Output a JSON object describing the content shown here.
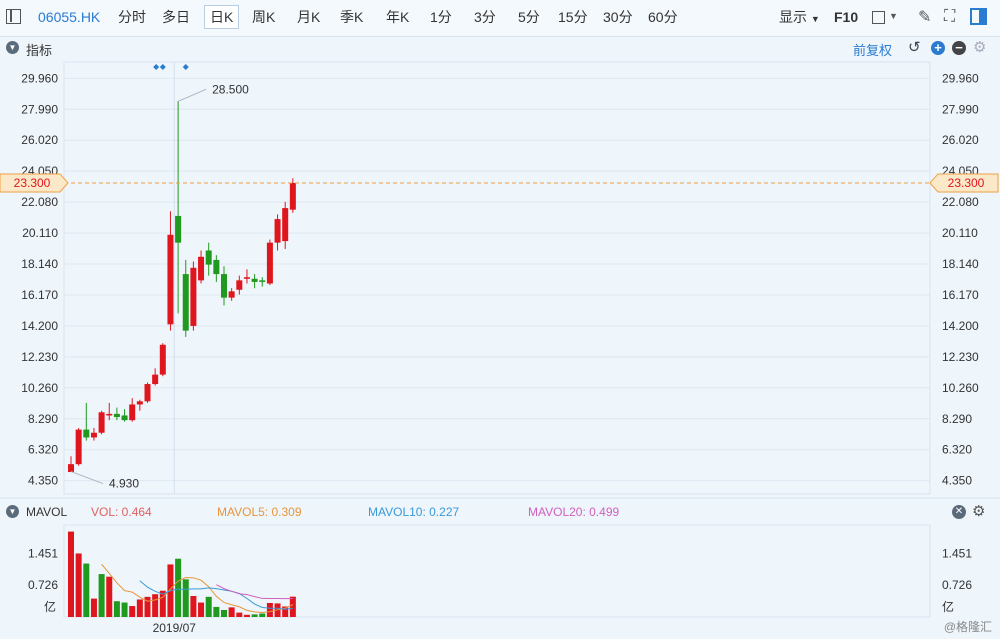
{
  "toolbar": {
    "symbol": "06055.HK",
    "periods": [
      "分时",
      "多日",
      "日K",
      "周K",
      "月K",
      "季K",
      "年K",
      "1分",
      "3分",
      "5分",
      "15分",
      "30分",
      "60分"
    ],
    "active_period": "日K",
    "display_label": "显示",
    "f10_label": "F10"
  },
  "indicator_bar": {
    "label": "指标",
    "adjust_label": "前复权"
  },
  "main_chart": {
    "y_ticks": [
      "29.960",
      "27.990",
      "26.020",
      "24.050",
      "22.080",
      "20.110",
      "18.140",
      "16.170",
      "14.200",
      "12.230",
      "10.260",
      "8.290",
      "6.320",
      "4.350"
    ],
    "current_price": "23.300",
    "high_label": "28.500",
    "low_label": "4.930"
  },
  "volume_bar": {
    "label": "MAVOL",
    "vol": "VOL: 0.464",
    "mavol5": "MAVOL5: 0.309",
    "mavol10": "MAVOL10: 0.227",
    "mavol20": "MAVOL20: 0.499",
    "y_ticks": [
      "1.451",
      "0.726"
    ],
    "unit": "亿",
    "x_label": "2019/07"
  },
  "watermark": "@格隆汇",
  "colors": {
    "up": "#e0161e",
    "down": "#1f9a1f",
    "accent": "#2b7bd0",
    "price_line": "#f0a040"
  },
  "chart_data": {
    "type": "candlestick",
    "ylim": [
      3.5,
      31.0
    ],
    "candles": [
      {
        "o": 4.9,
        "c": 5.4,
        "h": 5.9,
        "l": 4.93
      },
      {
        "o": 5.4,
        "c": 7.6,
        "h": 7.7,
        "l": 5.3
      },
      {
        "o": 7.6,
        "c": 7.1,
        "h": 9.3,
        "l": 6.9
      },
      {
        "o": 7.1,
        "c": 7.4,
        "h": 7.7,
        "l": 6.9
      },
      {
        "o": 7.4,
        "c": 8.7,
        "h": 8.8,
        "l": 7.3
      },
      {
        "o": 8.5,
        "c": 8.6,
        "h": 9.3,
        "l": 8.2
      },
      {
        "o": 8.6,
        "c": 8.4,
        "h": 9.0,
        "l": 8.2
      },
      {
        "o": 8.5,
        "c": 8.2,
        "h": 8.9,
        "l": 8.1
      },
      {
        "o": 8.2,
        "c": 9.2,
        "h": 9.6,
        "l": 8.1
      },
      {
        "o": 9.2,
        "c": 9.4,
        "h": 9.5,
        "l": 8.8
      },
      {
        "o": 9.4,
        "c": 10.5,
        "h": 10.6,
        "l": 9.3
      },
      {
        "o": 10.5,
        "c": 11.1,
        "h": 11.5,
        "l": 10.4
      },
      {
        "o": 11.1,
        "c": 13.0,
        "h": 13.1,
        "l": 11.0
      },
      {
        "o": 14.3,
        "c": 20.0,
        "h": 21.5,
        "l": 13.9
      },
      {
        "o": 21.2,
        "c": 19.5,
        "h": 28.5,
        "l": 15.0
      },
      {
        "o": 17.5,
        "c": 13.9,
        "h": 18.4,
        "l": 13.5
      },
      {
        "o": 14.2,
        "c": 17.9,
        "h": 18.3,
        "l": 13.9
      },
      {
        "o": 17.1,
        "c": 18.6,
        "h": 19.0,
        "l": 16.9
      },
      {
        "o": 19.0,
        "c": 18.1,
        "h": 19.5,
        "l": 17.4
      },
      {
        "o": 18.4,
        "c": 17.5,
        "h": 18.7,
        "l": 17.0
      },
      {
        "o": 17.5,
        "c": 16.0,
        "h": 18.0,
        "l": 15.5
      },
      {
        "o": 16.0,
        "c": 16.4,
        "h": 16.6,
        "l": 15.8
      },
      {
        "o": 16.5,
        "c": 17.1,
        "h": 17.4,
        "l": 16.2
      },
      {
        "o": 17.2,
        "c": 17.3,
        "h": 17.8,
        "l": 16.9
      },
      {
        "o": 17.2,
        "c": 17.0,
        "h": 17.5,
        "l": 16.6
      },
      {
        "o": 17.1,
        "c": 17.0,
        "h": 17.3,
        "l": 16.7
      },
      {
        "o": 16.9,
        "c": 19.5,
        "h": 19.7,
        "l": 16.8
      },
      {
        "o": 19.5,
        "c": 21.0,
        "h": 21.3,
        "l": 19.0
      },
      {
        "o": 19.6,
        "c": 21.7,
        "h": 22.1,
        "l": 19.1
      },
      {
        "o": 21.6,
        "c": 23.3,
        "h": 23.6,
        "l": 21.4
      }
    ],
    "volume": {
      "ylim": [
        0,
        2.1
      ],
      "values": [
        1.95,
        1.45,
        1.22,
        0.42,
        0.98,
        0.92,
        0.36,
        0.33,
        0.25,
        0.4,
        0.46,
        0.52,
        0.6,
        1.2,
        1.33,
        0.86,
        0.48,
        0.33,
        0.46,
        0.23,
        0.16,
        0.22,
        0.1,
        0.05,
        0.06,
        0.08,
        0.32,
        0.31,
        0.24,
        0.464
      ],
      "up": [
        1,
        1,
        0,
        1,
        0,
        1,
        0,
        0,
        1,
        1,
        1,
        1,
        1,
        1,
        0,
        0,
        1,
        1,
        0,
        0,
        0,
        1,
        1,
        1,
        0,
        0,
        1,
        1,
        1,
        1
      ]
    }
  }
}
